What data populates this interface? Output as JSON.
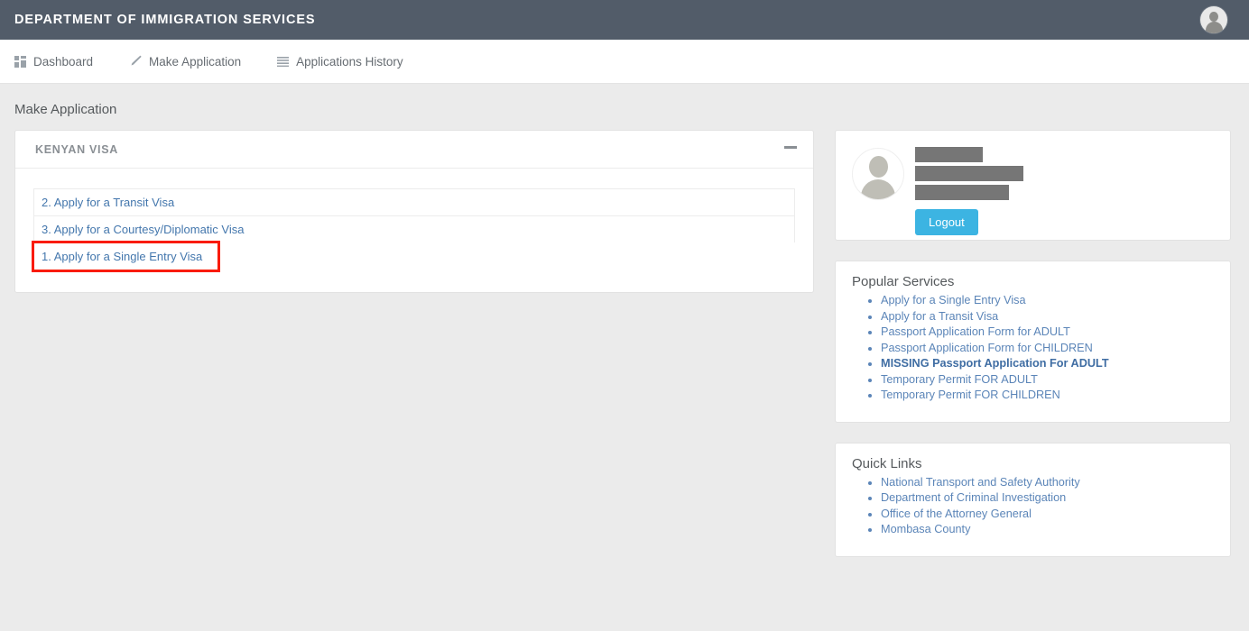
{
  "header": {
    "brand": "DEPARTMENT OF IMMIGRATION SERVICES",
    "avatar_icon": "user-avatar-icon"
  },
  "nav": {
    "items": [
      {
        "label": "Dashboard",
        "icon": "grid-icon"
      },
      {
        "label": "Make Application",
        "icon": "pencil-icon"
      },
      {
        "label": "Applications History",
        "icon": "list-icon"
      }
    ]
  },
  "page": {
    "title": "Make Application"
  },
  "panel": {
    "title": "KENYAN VISA",
    "collapse_icon": "minus-icon",
    "items": [
      {
        "label": "2. Apply for a Transit Visa",
        "highlighted": false
      },
      {
        "label": "3. Apply for a Courtesy/Diplomatic Visa",
        "highlighted": false
      },
      {
        "label": "1. Apply for a Single Entry Visa",
        "highlighted": true
      }
    ]
  },
  "profile": {
    "avatar_icon": "user-avatar-icon",
    "redacted_fields": [
      {
        "name": "user-name",
        "width": 75
      },
      {
        "name": "user-email",
        "width": 120
      },
      {
        "name": "user-phone",
        "width": 104
      }
    ],
    "logout_label": "Logout"
  },
  "popular_services": {
    "title": "Popular Services",
    "items": [
      {
        "label": "Apply for a Single Entry Visa",
        "bold": false
      },
      {
        "label": "Apply for a Transit Visa",
        "bold": false
      },
      {
        "label": "Passport Application Form for ADULT",
        "bold": false
      },
      {
        "label": "Passport Application Form for CHILDREN",
        "bold": false
      },
      {
        "label": "MISSING Passport Application For ADULT",
        "bold": true
      },
      {
        "label": "Temporary Permit FOR ADULT",
        "bold": false
      },
      {
        "label": "Temporary Permit FOR CHILDREN",
        "bold": false
      }
    ]
  },
  "quick_links": {
    "title": "Quick Links",
    "items": [
      {
        "label": "National Transport and Safety Authority"
      },
      {
        "label": "Department of Criminal Investigation"
      },
      {
        "label": "Office of the Attorney General"
      },
      {
        "label": "Mombasa County"
      }
    ]
  },
  "colors": {
    "header_bg": "#525c69",
    "page_bg": "#ebebeb",
    "link": "#4477ad",
    "accent_button": "#3cb4e2",
    "highlight_outline": "#f91b06",
    "redaction": "#767676"
  }
}
